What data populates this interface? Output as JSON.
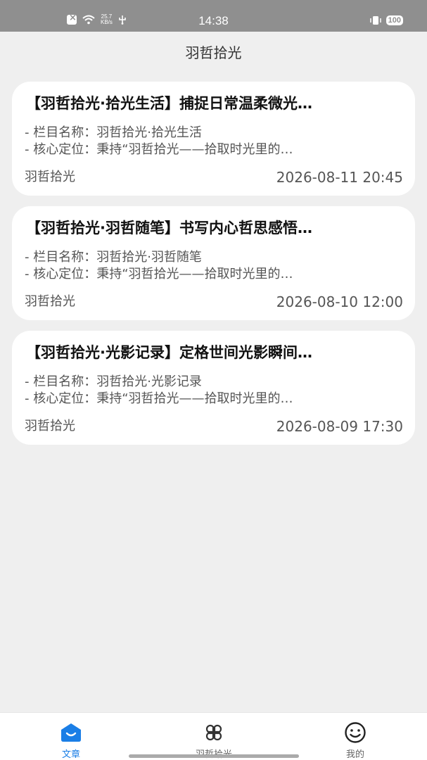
{
  "status_bar": {
    "speed_value": "25.7",
    "speed_unit": "KB/s",
    "time": "14:38",
    "battery": "100"
  },
  "header": {
    "title": "羽哲拾光"
  },
  "articles": [
    {
      "title": "【羽哲拾光·拾光生活】捕捉日常温柔微光…",
      "line1": "- 栏目名称：羽哲拾光·拾光生活",
      "line2": "- 核心定位：秉持“羽哲拾光——拾取时光里的…",
      "author": "羽哲拾光",
      "date": "2026-08-11 20:45"
    },
    {
      "title": "【羽哲拾光·羽哲随笔】书写内心哲思感悟…",
      "line1": "- 栏目名称：羽哲拾光·羽哲随笔",
      "line2": "- 核心定位：秉持“羽哲拾光——拾取时光里的…",
      "author": "羽哲拾光",
      "date": "2026-08-10 12:00"
    },
    {
      "title": "【羽哲拾光·光影记录】定格世间光影瞬间…",
      "line1": "- 栏目名称：羽哲拾光·光影记录",
      "line2": "- 核心定位：秉持“羽哲拾光——拾取时光里的…",
      "author": "羽哲拾光",
      "date": "2026-08-09 17:30"
    }
  ],
  "bottom_nav": {
    "items": [
      {
        "label": "文章",
        "icon": "article-home-icon",
        "active": true
      },
      {
        "label": "羽哲拾光",
        "icon": "four-petal-grid-icon",
        "active": false
      },
      {
        "label": "我的",
        "icon": "smiley-profile-icon",
        "active": false
      }
    ]
  },
  "colors": {
    "accent": "#1a7ee6",
    "background": "#efefef",
    "card": "#ffffff",
    "status_bar": "#8f8f8f"
  }
}
